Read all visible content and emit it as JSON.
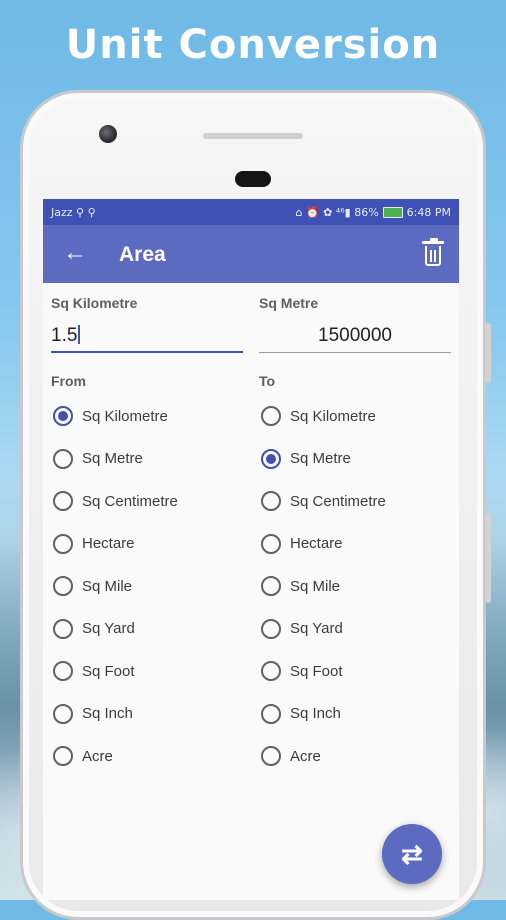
{
  "promo": {
    "headline": "Unit Conversion"
  },
  "status_bar": {
    "carrier": "Jazz ⚲ ⚲",
    "icons": "⌂ ⏰ ✿ ⁴⁶▮ 86%",
    "battery": "86%",
    "time": "6:48 PM"
  },
  "app_bar": {
    "title": "Area",
    "back_icon": "arrow-left-icon",
    "delete_icon": "trash-icon",
    "color": "#5c6bc0",
    "status_color": "#3f51b5"
  },
  "input_from": {
    "label": "Sq Kilometre",
    "value": "1.5"
  },
  "input_to": {
    "label": "Sq Metre",
    "value": "1500000"
  },
  "from": {
    "label": "From",
    "options": [
      {
        "label": "Sq Kilometre",
        "checked": true
      },
      {
        "label": "Sq Metre",
        "checked": false
      },
      {
        "label": "Sq Centimetre",
        "checked": false
      },
      {
        "label": "Hectare",
        "checked": false
      },
      {
        "label": "Sq Mile",
        "checked": false
      },
      {
        "label": "Sq Yard",
        "checked": false
      },
      {
        "label": "Sq Foot",
        "checked": false
      },
      {
        "label": "Sq Inch",
        "checked": false
      },
      {
        "label": "Acre",
        "checked": false
      }
    ]
  },
  "to": {
    "label": "To",
    "options": [
      {
        "label": "Sq Kilometre",
        "checked": false
      },
      {
        "label": "Sq Metre",
        "checked": true
      },
      {
        "label": "Sq Centimetre",
        "checked": false
      },
      {
        "label": "Hectare",
        "checked": false
      },
      {
        "label": "Sq Mile",
        "checked": false
      },
      {
        "label": "Sq Yard",
        "checked": false
      },
      {
        "label": "Sq Foot",
        "checked": false
      },
      {
        "label": "Sq Inch",
        "checked": false
      },
      {
        "label": "Acre",
        "checked": false
      }
    ]
  },
  "fab": {
    "icon": "swap-icon",
    "glyph": "⇄"
  }
}
